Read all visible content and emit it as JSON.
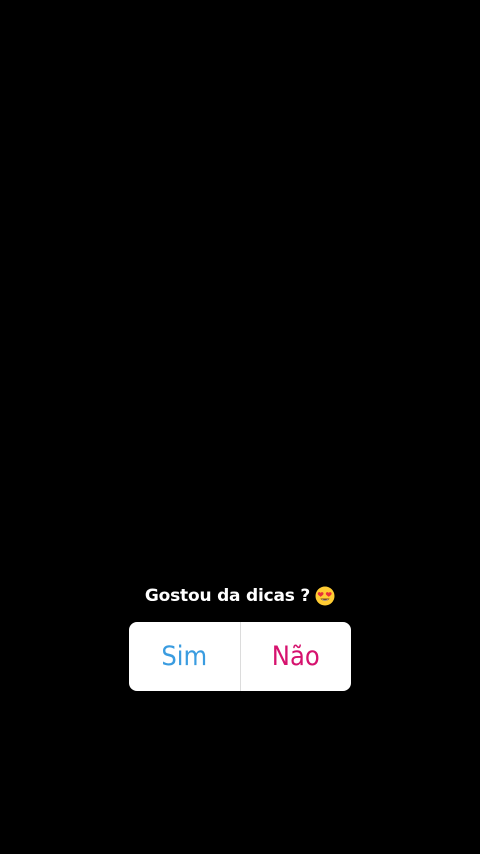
{
  "poll": {
    "question": "Gostou da dicas ?",
    "emoji_icon": "smiling-face-with-heart-eyes-icon",
    "options": [
      {
        "label": "Sim",
        "color": "#3a9ce0"
      },
      {
        "label": "Não",
        "color": "#d6126e"
      }
    ]
  },
  "colors": {
    "background": "#000000",
    "question_text": "#ffffff",
    "poll_box": "#ffffff"
  }
}
